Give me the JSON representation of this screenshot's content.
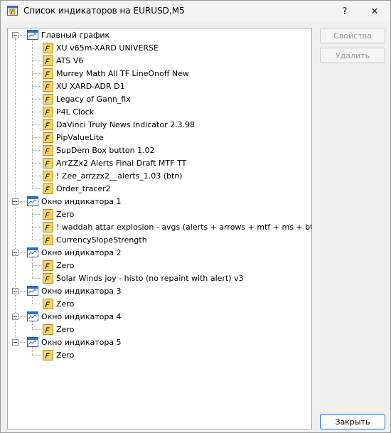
{
  "window": {
    "title": "Список индикаторов на EURUSD,M5",
    "help_glyph": "?",
    "close_glyph": "✕"
  },
  "tree": [
    {
      "label": "Главный график",
      "indicators": [
        "XU v65m-XARD UNIVERSE",
        "ATS V6",
        "Murrey Math All TF LineOnoff New",
        "XU XARD-ADR D1",
        "Legacy of Gann_fix",
        "P4L Clock",
        "DaVinci Truly News Indicator 2.3.98",
        "PipValueLite",
        "SupDem Box button 1.02",
        "ArrZZx2 Alerts Final Draft MTF TT",
        "! Zee_arrzzx2__alerts_1.03 (btn)",
        "Order_tracer2"
      ]
    },
    {
      "label": "Окно индикатора 1",
      "indicators": [
        "Zero",
        "! waddah attar explosion - avgs (alerts + arrows + mtf + ms + btn)",
        "CurrencySlopeStrength"
      ]
    },
    {
      "label": "Окно индикатора 2",
      "indicators": [
        "Zero",
        "Solar Winds joy - histo (no repaint with alert) v3"
      ]
    },
    {
      "label": "Окно индикатора 3",
      "indicators": [
        "Zero"
      ]
    },
    {
      "label": "Окно индикатора 4",
      "indicators": [
        "Zero"
      ]
    },
    {
      "label": "Окно индикатора 5",
      "indicators": [
        "Zero"
      ]
    }
  ],
  "buttons": {
    "properties": "Свойства",
    "delete": "Удалить",
    "close": "Закрыть"
  },
  "icons": {
    "window_node": "chart-window-icon",
    "indicator_node": "indicator-icon",
    "expander": "collapse-icon"
  }
}
